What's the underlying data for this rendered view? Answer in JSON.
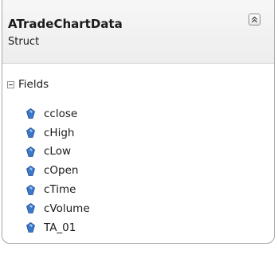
{
  "header": {
    "type_name": "ATradeChartData",
    "type_kind": "Struct"
  },
  "section": {
    "label": "Fields",
    "state": "expanded"
  },
  "fields": [
    {
      "label": "cclose",
      "icon": "field-icon"
    },
    {
      "label": "cHigh",
      "icon": "field-icon"
    },
    {
      "label": "cLow",
      "icon": "field-icon"
    },
    {
      "label": "cOpen",
      "icon": "field-icon"
    },
    {
      "label": "cTime",
      "icon": "field-icon"
    },
    {
      "label": "cVolume",
      "icon": "field-icon"
    },
    {
      "label": "TA_01",
      "icon": "field-icon"
    }
  ],
  "colors": {
    "field_icon": "#3c78c8",
    "border": "#a6a6a6"
  }
}
